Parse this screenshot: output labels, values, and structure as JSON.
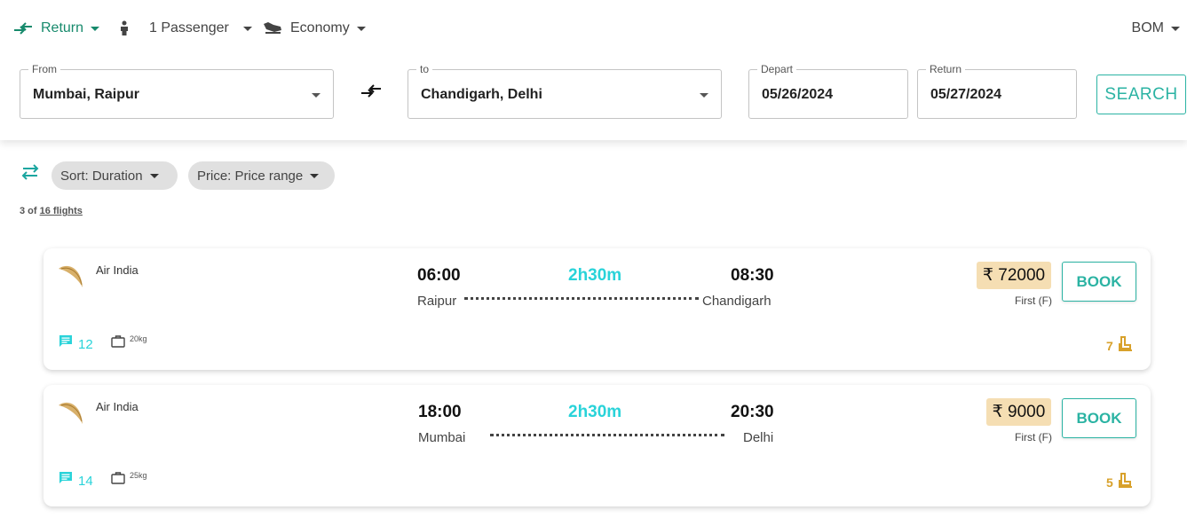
{
  "topbar": {
    "trip_type": "Return",
    "passengers": "1 Passenger",
    "cabin": "Economy",
    "currency": "BOM"
  },
  "search": {
    "from_label": "From",
    "from_value": "Mumbai, Raipur",
    "to_label": "to",
    "to_value": "Chandigarh, Delhi",
    "depart_label": "Depart",
    "depart_value": "05/26/2024",
    "return_label": "Return",
    "return_value": "05/27/2024",
    "search_button": "SEARCH"
  },
  "filters": {
    "sort": "Sort: Duration",
    "price": "Price: Price range",
    "count_prefix": "3 of",
    "count_link": "16 flights"
  },
  "flights": [
    {
      "airline": "Air India",
      "dep_time": "06:00",
      "duration": "2h30m",
      "arr_time": "08:30",
      "origin": "Raipur",
      "destination": "Chandigarh",
      "price": "₹ 72000",
      "fare_class": "First (F)",
      "book_label": "BOOK",
      "comments": "12",
      "baggage": "20kg",
      "seats": "7"
    },
    {
      "airline": "Air India",
      "dep_time": "18:00",
      "duration": "2h30m",
      "arr_time": "20:30",
      "origin": "Mumbai",
      "destination": "Delhi",
      "price": "₹ 9000",
      "fare_class": "First (F)",
      "book_label": "BOOK",
      "comments": "14",
      "baggage": "25kg",
      "seats": "5"
    }
  ],
  "colors": {
    "accent_green": "#178a6c",
    "teal": "#2bb3a3",
    "cyan": "#29d3d9",
    "price_bg": "#f5deb3",
    "seat_gold": "#d8a12b"
  },
  "icons": [
    "swap-arrows-icon",
    "person-icon",
    "seat-icon",
    "filter-icon",
    "chat-icon",
    "briefcase-icon",
    "airline-logo"
  ]
}
